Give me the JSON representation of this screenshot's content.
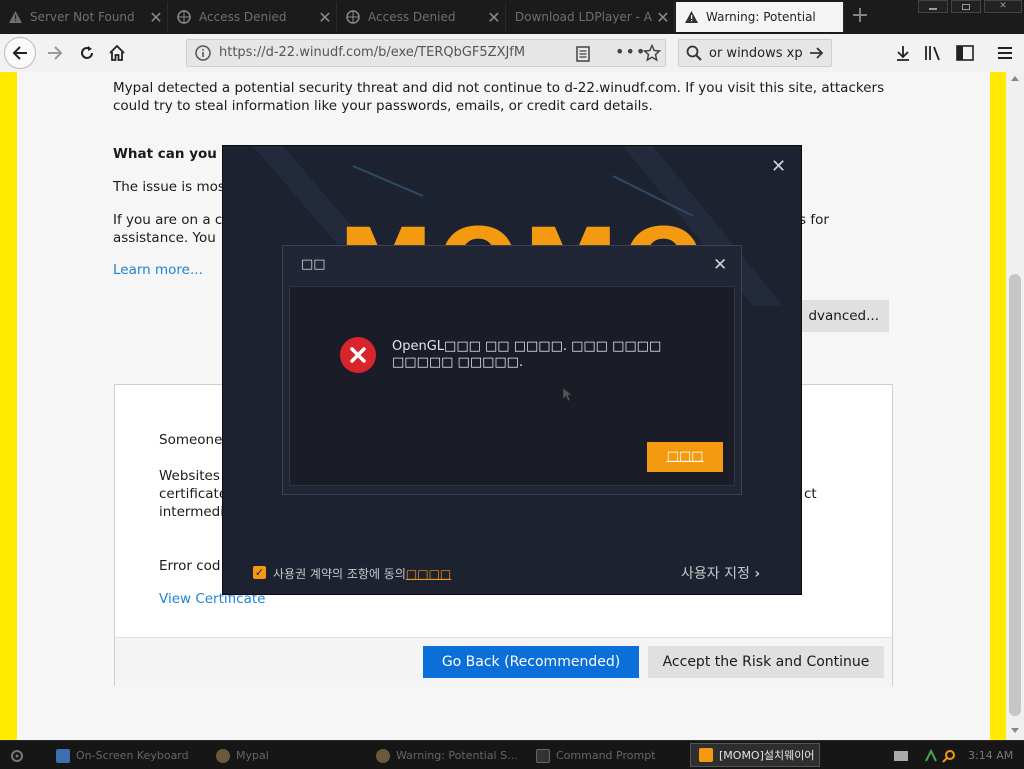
{
  "browser": {
    "tabs": [
      {
        "label": "Server Not Found",
        "icon": "warning-triangle-icon",
        "active": false
      },
      {
        "label": "Access Denied",
        "icon": "globe-icon",
        "active": false
      },
      {
        "label": "Access Denied",
        "icon": "globe-icon",
        "active": false
      },
      {
        "label": "Download LDPlayer - A",
        "icon": "none",
        "active": false
      },
      {
        "label": "Warning: Potential",
        "icon": "warning-triangle-icon",
        "active": true
      }
    ],
    "new_tab_label": "+",
    "url": "https://d-22.winudf.com/b/exe/TERQbGF5ZXJfM",
    "search_value": "or windows xp",
    "close_glyph": "✕"
  },
  "warning_page": {
    "intro": "Mypal detected a potential security threat and did not continue to d-22.winudf.com. If you visit this site, attackers could try to steal information like your passwords, emails, or credit card details.",
    "what_heading": "What can you",
    "issue_line": "The issue is mos",
    "if_line_1_left": "If you are on a c",
    "if_line_1_right": "s for",
    "if_line_2": "assistance. You",
    "learn_more": "Learn more...",
    "advanced_button": "dvanced...",
    "details": {
      "someone": "Someone",
      "websites": "Websites",
      "certificate": "certificate",
      "intermediate": "intermedi",
      "ct_fragment": "ct",
      "error_code": "Error cod",
      "view_certificate": "View Certificate"
    },
    "go_back_button": "Go Back (Recommended)",
    "accept_button": "Accept the Risk and Continue"
  },
  "momo_installer": {
    "logo_text": "MOMO",
    "close_glyph": "✕",
    "license_text": "사용권 계약의 조항에 동의",
    "license_link": "□□□□",
    "custom_install": "사용자 지정",
    "accent_color": "#f39a11"
  },
  "error_dialog": {
    "title": "□□",
    "message_line1": "OpenGL□□□ □□ □□□□. □□□ □□□□",
    "message_line2": "□□□□□ □□□□□.",
    "ok_button": "□□□",
    "close_glyph": "✕"
  },
  "taskbar": {
    "items": [
      {
        "label": "On-Screen Keyboard",
        "icon": "keyboard-icon"
      },
      {
        "label": "Mypal",
        "icon": "mypal-icon"
      },
      {
        "label": "Warning: Potential S...",
        "icon": "mypal-icon"
      },
      {
        "label": "Command Prompt",
        "icon": "cmd-icon"
      },
      {
        "label": "[MOMO]설치웨이어",
        "icon": "momo-icon"
      }
    ],
    "clock": "3:14 AM"
  }
}
